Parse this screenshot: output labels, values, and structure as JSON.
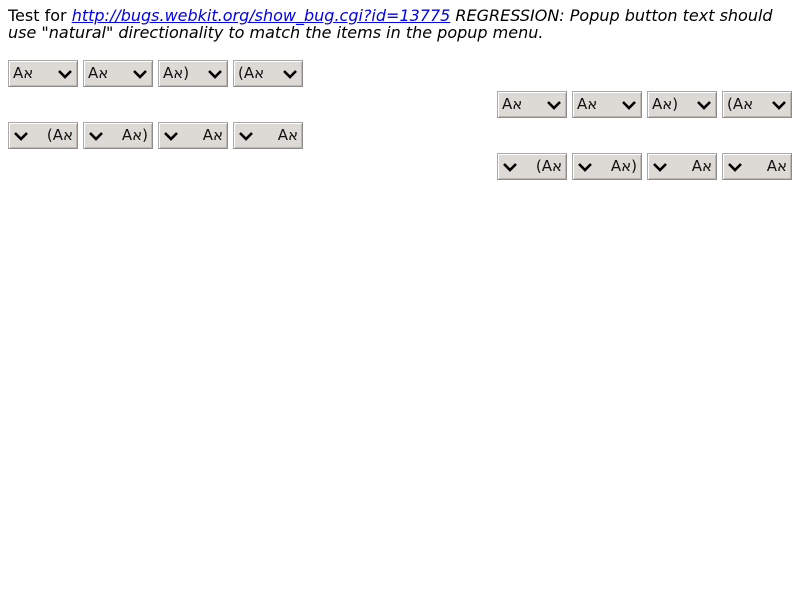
{
  "description": {
    "prefix": "Test for ",
    "link_text": "http://bugs.webkit.org/show_bug.cgi?id=13775",
    "suffix": " REGRESSION: Popup button text should use \"natural\" directionality to match the items in the popup menu."
  },
  "rows": [
    {
      "labels": [
        "אA",
        "Aא",
        "(אA",
        "(Aא"
      ]
    },
    {
      "labels": [
        "אA",
        "Aא",
        "(אA",
        "(Aא"
      ]
    },
    {
      "labels": [
        "אA)",
        "Aא)",
        "אA",
        "Aא"
      ]
    },
    {
      "labels": [
        "אA)",
        "Aא)",
        "אA",
        "Aא"
      ]
    }
  ],
  "icons": {
    "popup_arrow": "chevron-down-icon"
  },
  "colors": {
    "link": "#0000ee",
    "button_face": "#dddad5",
    "button_border": "#a9a9a9"
  }
}
